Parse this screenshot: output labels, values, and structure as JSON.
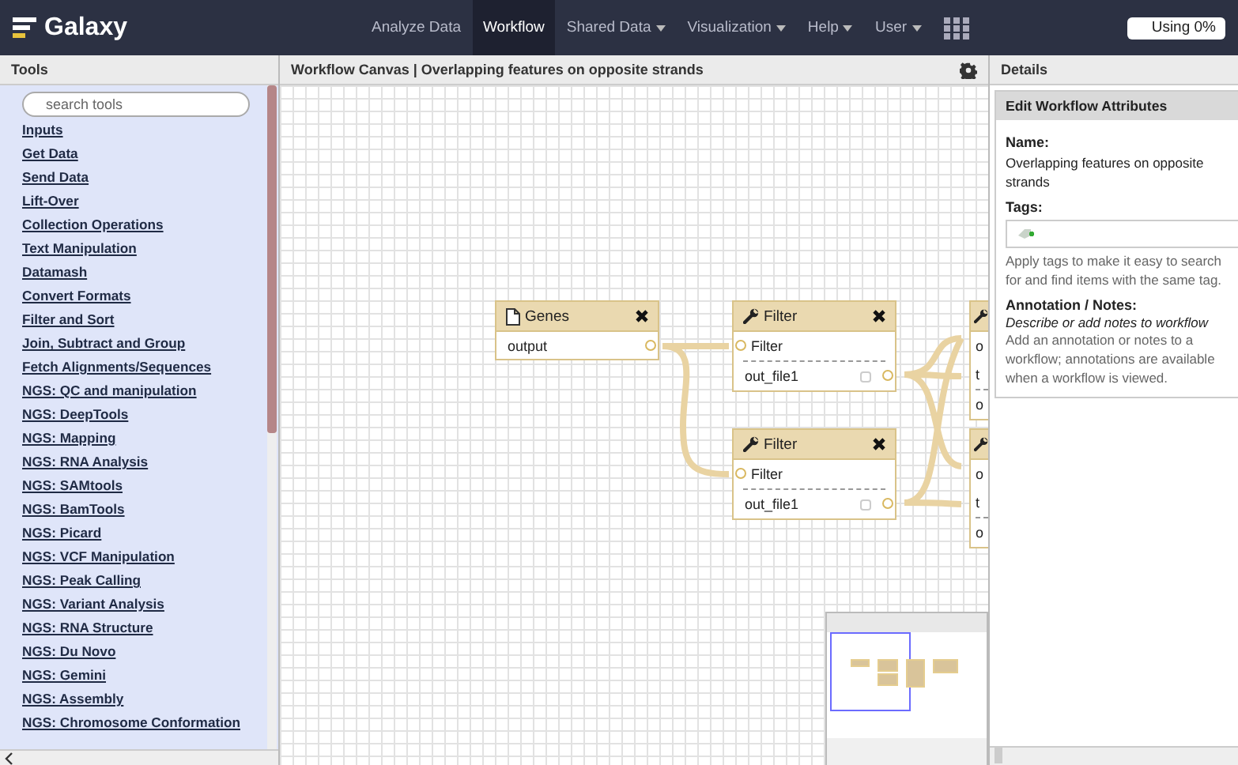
{
  "navbar": {
    "brand": "Galaxy",
    "items": [
      {
        "label": "Analyze Data",
        "selected": false,
        "dropdown": false
      },
      {
        "label": "Workflow",
        "selected": true,
        "dropdown": false
      },
      {
        "label": "Shared Data",
        "selected": false,
        "dropdown": true
      },
      {
        "label": "Visualization",
        "selected": false,
        "dropdown": true
      },
      {
        "label": "Help",
        "selected": false,
        "dropdown": true
      },
      {
        "label": "User",
        "selected": false,
        "dropdown": true
      }
    ],
    "usage": "Using 0%"
  },
  "tools_panel": {
    "title": "Tools",
    "search": {
      "placeholder": "search tools"
    },
    "sections": [
      "Inputs",
      "Get Data",
      "Send Data",
      "Lift-Over",
      "Collection Operations",
      "Text Manipulation",
      "Datamash",
      "Convert Formats",
      "Filter and Sort",
      "Join, Subtract and Group",
      "Fetch Alignments/Sequences",
      "NGS: QC and manipulation",
      "NGS: DeepTools",
      "NGS: Mapping",
      "NGS: RNA Analysis",
      "NGS: SAMtools",
      "NGS: BamTools",
      "NGS: Picard",
      "NGS: VCF Manipulation",
      "NGS: Peak Calling",
      "NGS: Variant Analysis",
      "NGS: RNA Structure",
      "NGS: Du Novo",
      "NGS: Gemini",
      "NGS: Assembly",
      "NGS: Chromosome Conformation"
    ]
  },
  "canvas": {
    "title": "Workflow Canvas | Overlapping features on opposite strands",
    "nodes": [
      {
        "kind": "input",
        "title": "Genes",
        "outputs": [
          {
            "label": "output"
          }
        ]
      },
      {
        "kind": "tool",
        "title": "Filter",
        "inputs": [
          "Filter"
        ],
        "outputs": [
          {
            "label": "out_file1",
            "checked": false
          }
        ]
      },
      {
        "kind": "tool",
        "title": "Filter",
        "inputs": [
          "Filter"
        ],
        "outputs": [
          {
            "label": "out_file1",
            "checked": false
          }
        ]
      },
      {
        "kind": "partial",
        "inputs": [
          "o",
          "t"
        ],
        "outputs": [
          {
            "label": "o"
          }
        ]
      },
      {
        "kind": "partial",
        "inputs": [
          "o",
          "t"
        ],
        "outputs": [
          {
            "label": "o"
          }
        ]
      }
    ]
  },
  "details": {
    "title": "Details",
    "heading": "Edit Workflow Attributes",
    "name_label": "Name:",
    "name_value": "Overlapping features on opposite strands",
    "tags_label": "Tags:",
    "tags_help": "Apply tags to make it easy to search for and find items with the same tag.",
    "annotation_label": "Annotation / Notes:",
    "annotation_placeholder": "Describe or add notes to workflow",
    "annotation_help": "Add an annotation or notes to a workflow; annotations are available when a workflow is viewed."
  }
}
